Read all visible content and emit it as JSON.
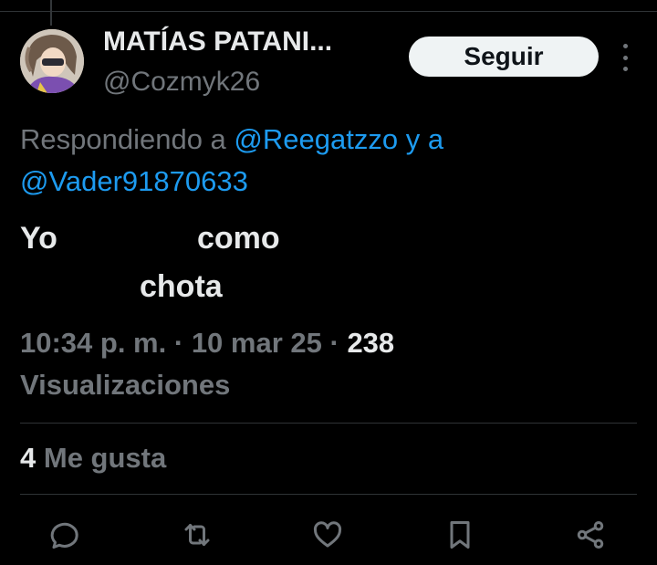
{
  "user": {
    "display_name": "MATÍAS PATANI...",
    "handle": "@Cozmyk26"
  },
  "follow_label": "Seguir",
  "replying": {
    "prefix": "Respondiendo a ",
    "mention_1": "@Reegatzzo",
    "joiner": " y a",
    "mention_2": "@Vader91870633"
  },
  "tweet": {
    "word_1": "Yo",
    "word_2": "como",
    "word_3": "chota"
  },
  "meta": {
    "time": "10:34 p. m.",
    "sep": " · ",
    "date": "10 mar 25",
    "views_count": "238",
    "views_label": "Visualizaciones"
  },
  "likes": {
    "count": "4",
    "label": "Me gusta"
  },
  "icons": {
    "reply": "reply-icon",
    "retweet": "retweet-icon",
    "like": "heart-icon",
    "bookmark": "bookmark-icon",
    "share": "share-icon",
    "more": "more-icon"
  },
  "colors": {
    "background": "#000000",
    "text": "#e7e9ea",
    "muted": "#71767b",
    "link": "#1d9bf0",
    "follow_bg": "#eff3f4"
  }
}
